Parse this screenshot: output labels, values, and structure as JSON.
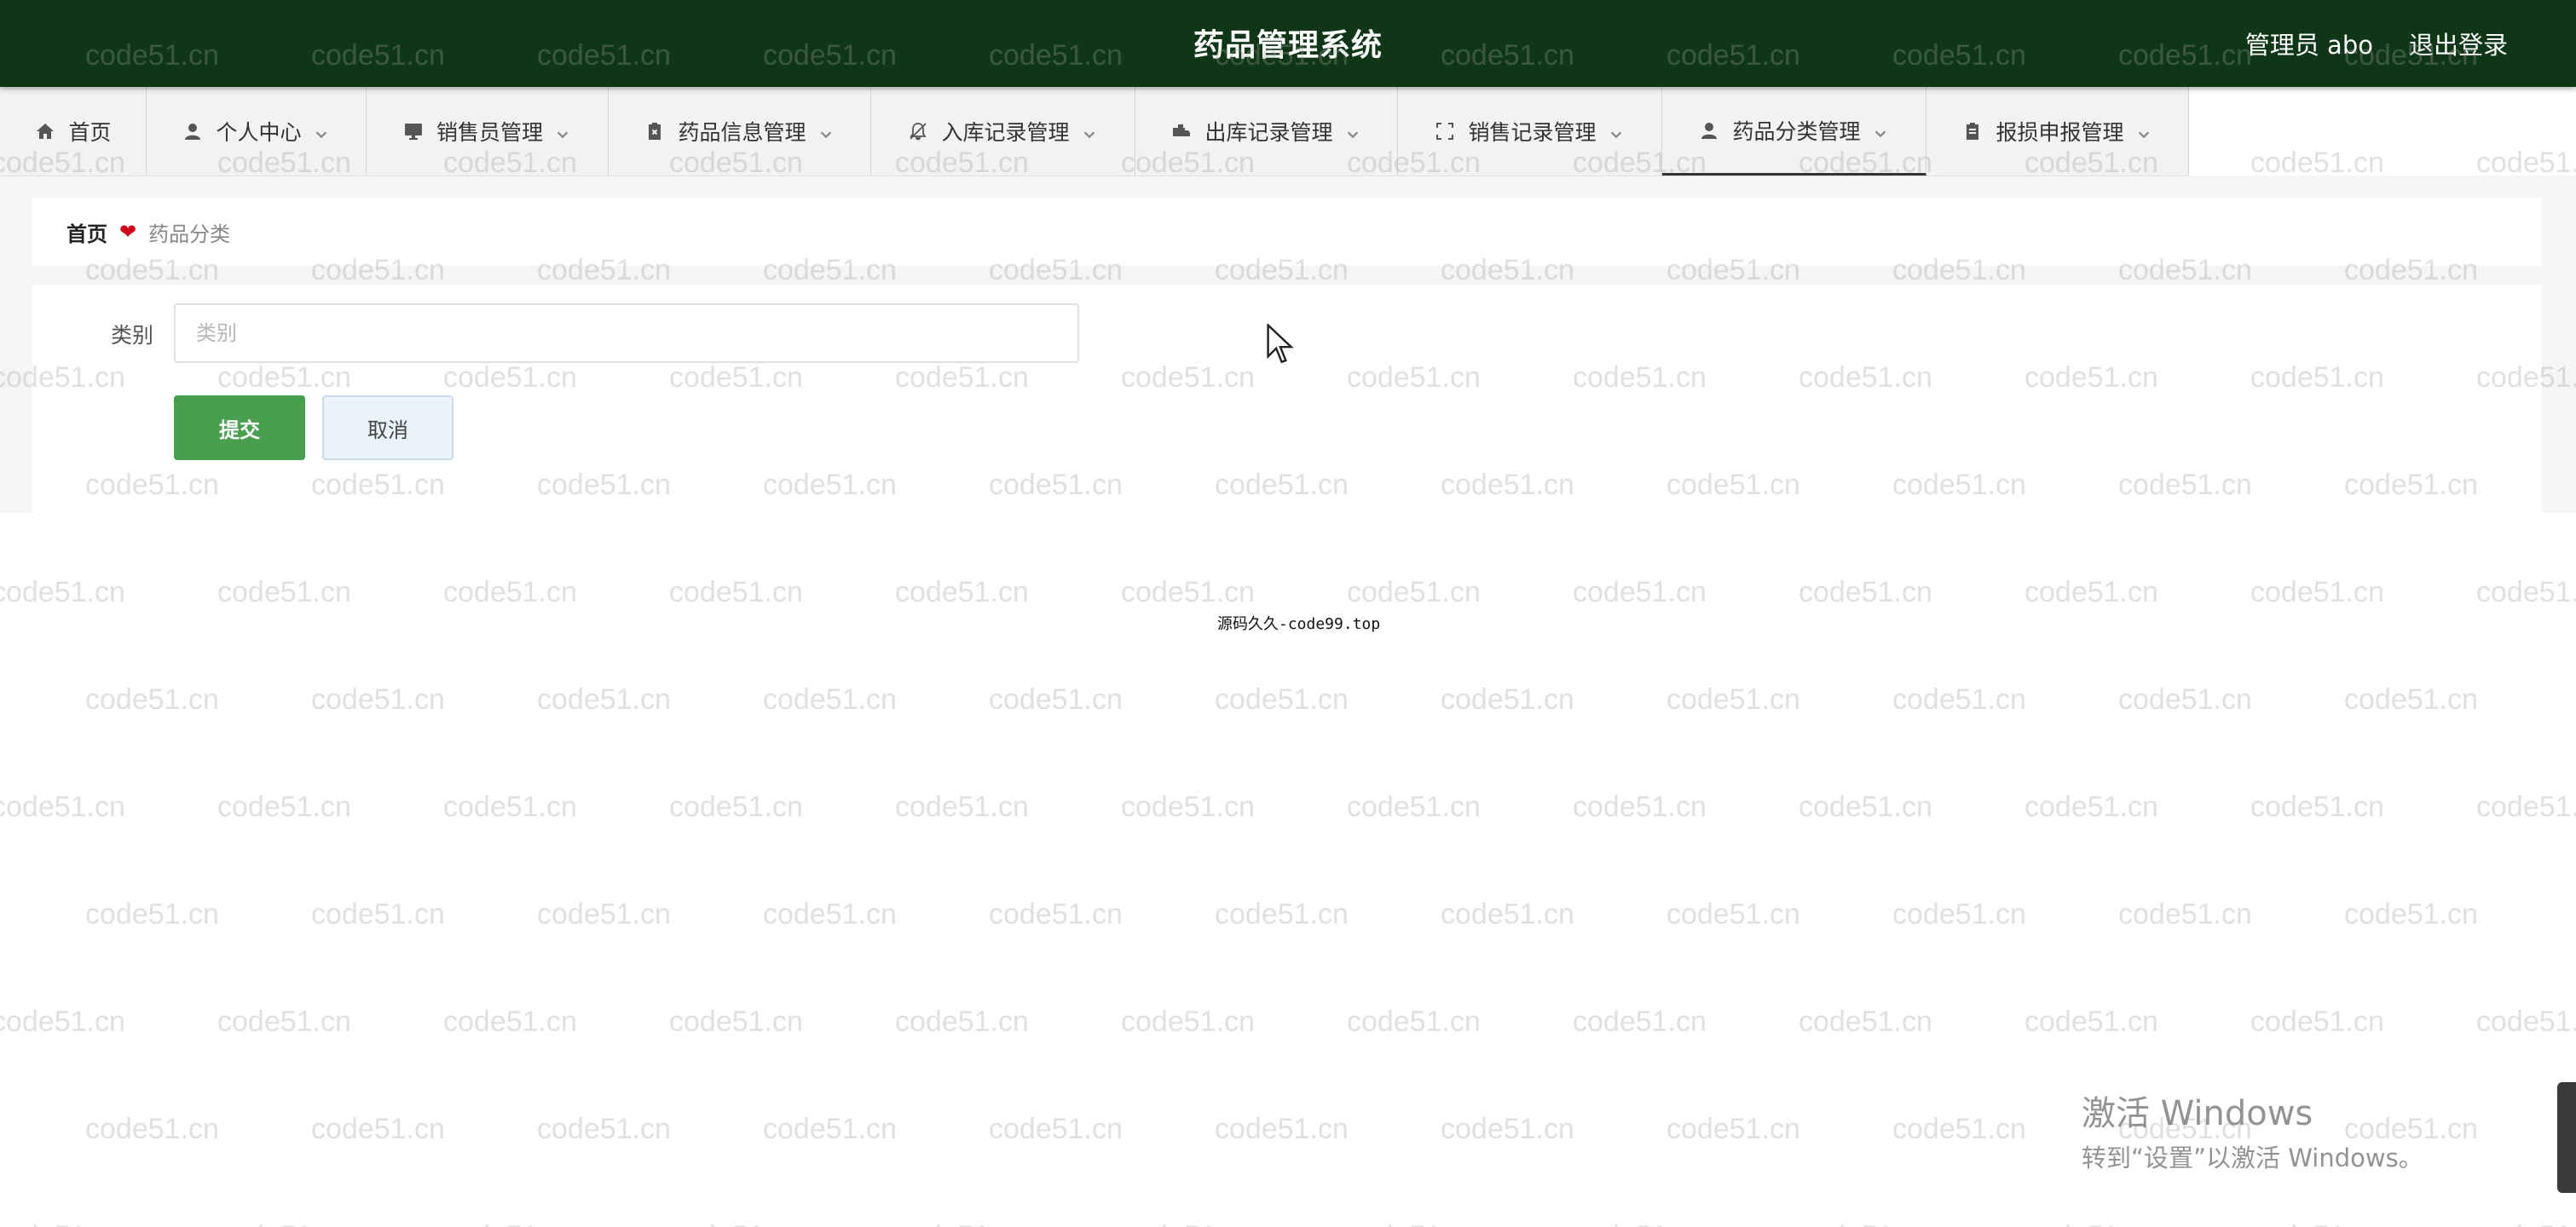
{
  "header": {
    "title": "药品管理系统",
    "user_label": "管理员 abo",
    "logout_label": "退出登录"
  },
  "nav": {
    "items": [
      {
        "label": "首页",
        "icon": "home-icon"
      },
      {
        "label": "个人中心",
        "icon": "person-icon"
      },
      {
        "label": "销售员管理",
        "icon": "monitor-icon"
      },
      {
        "label": "药品信息管理",
        "icon": "clipboard-x-icon"
      },
      {
        "label": "入库记录管理",
        "icon": "bell-off-icon"
      },
      {
        "label": "出库记录管理",
        "icon": "truck-icon"
      },
      {
        "label": "销售记录管理",
        "icon": "frame-icon"
      },
      {
        "label": "药品分类管理",
        "icon": "person-icon"
      },
      {
        "label": "报损申报管理",
        "icon": "clipboard-icon"
      }
    ],
    "active_index": 7
  },
  "breadcrumb": {
    "home": "首页",
    "current": "药品分类"
  },
  "form": {
    "category_label": "类别",
    "category_placeholder": "类别",
    "category_value": "",
    "submit_label": "提交",
    "cancel_label": "取消"
  },
  "watermark": "code51.cn",
  "footer_note": "源码久久-code99.top",
  "windows_activation": {
    "line1": "激活 Windows",
    "line2": "转到“设置”以激活 Windows。"
  },
  "colors": {
    "header_bg": "#0f3616",
    "submit_bg": "#4a9e4f",
    "cancel_bg": "#eaf2fc",
    "heart": "#d0021b"
  }
}
